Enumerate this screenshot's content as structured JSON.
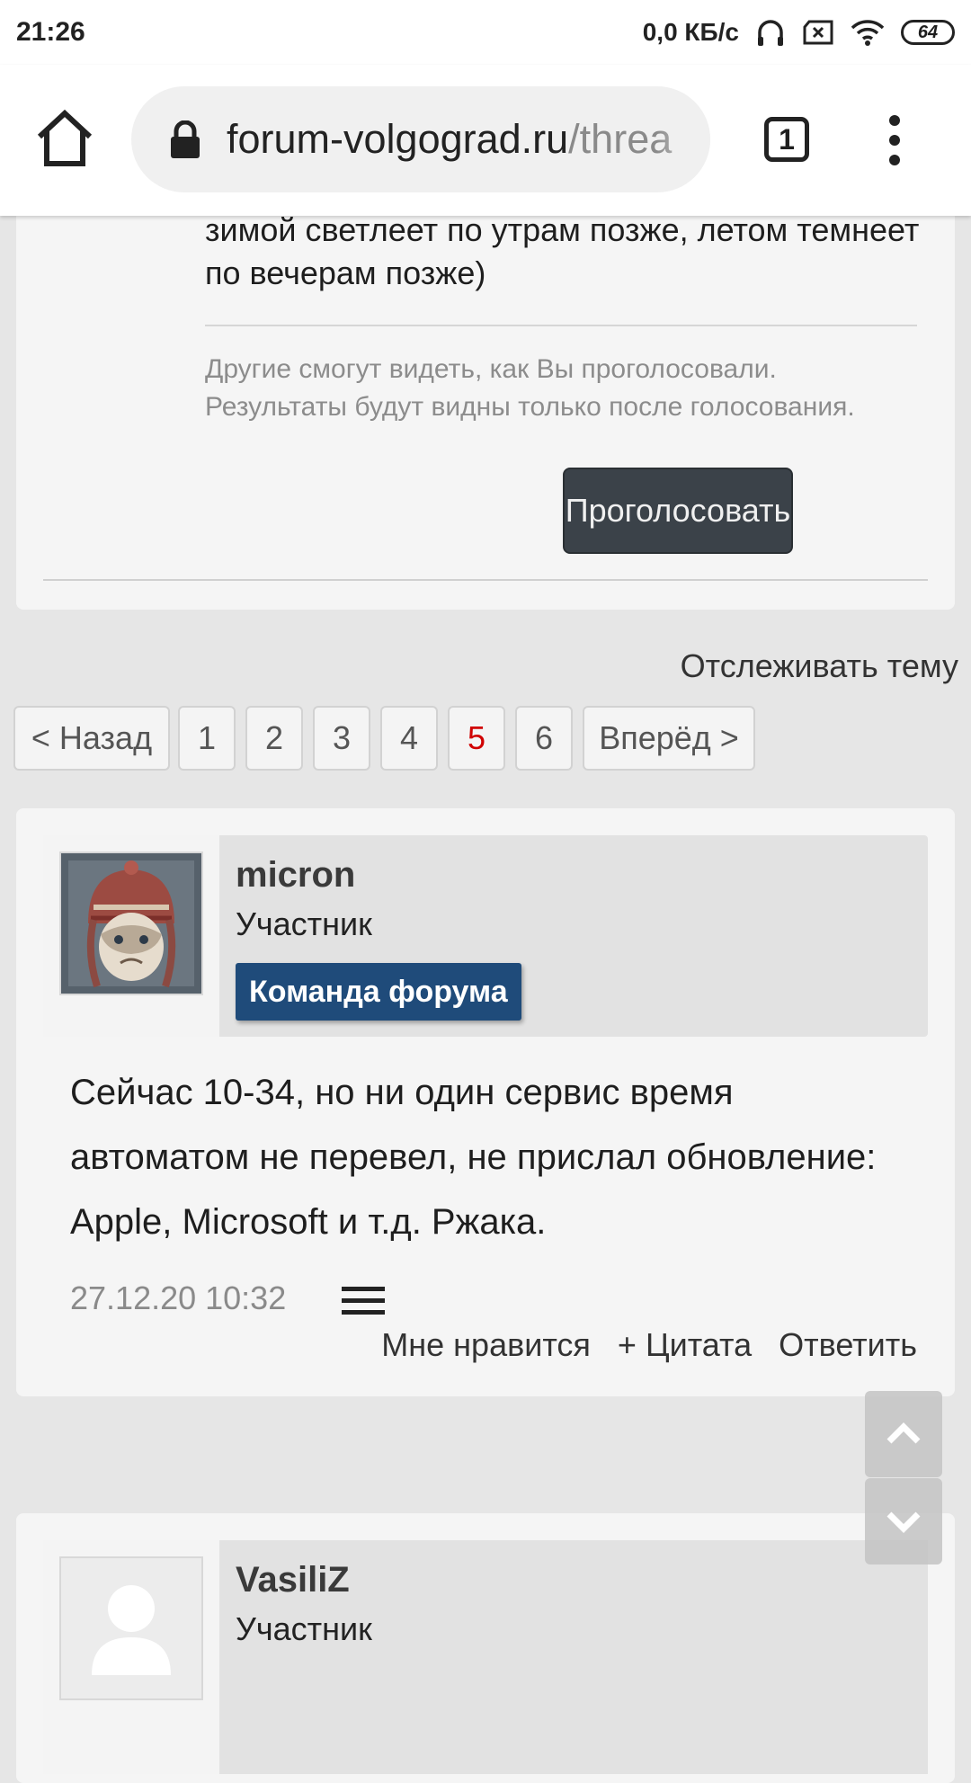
{
  "status_bar": {
    "time": "21:26",
    "net_speed": "0,0 КБ/с",
    "battery": "64",
    "icons": [
      "headphones-icon",
      "sim-off-icon",
      "wifi-icon",
      "battery-icon"
    ]
  },
  "browser": {
    "url_domain": "forum-volgograd.ru",
    "url_path": "/threa",
    "tab_count": "1",
    "icons": [
      "home-icon",
      "lock-icon",
      "tabs-icon",
      "more-vert-icon"
    ]
  },
  "poll": {
    "option_text": "зимой светлеет по утрам позже, летом темнеет по вечерам позже)",
    "note": "Другие смогут видеть, как Вы проголосовали. Результаты будут видны только после голосования.",
    "vote_button": "Проголосовать"
  },
  "thread": {
    "watch_label": "Отслеживать тему",
    "pagination": {
      "prev": "< Назад",
      "pages": [
        "1",
        "2",
        "3",
        "4",
        "5",
        "6"
      ],
      "current": "5",
      "next": "Вперёд >"
    }
  },
  "posts": [
    {
      "username": "micron",
      "user_title": "Участник",
      "badge": "Команда форума",
      "body": "Сейчас 10-34, но ни один сервис время автоматом не перевел, не прислал обновление: Apple, Microsoft и т.д. Ржака.",
      "date": "27.12.20 10:32",
      "actions": [
        "Мне нравится",
        "+ Цитата",
        "Ответить"
      ]
    },
    {
      "username": "VasiliZ",
      "user_title": "Участник"
    }
  ],
  "colors": {
    "page_bg": "#e6e6e6",
    "card_bg": "#f5f5f5",
    "badge_bg": "#1f4b7a",
    "button_bg": "#3b4249",
    "current_page": "#d00000"
  }
}
